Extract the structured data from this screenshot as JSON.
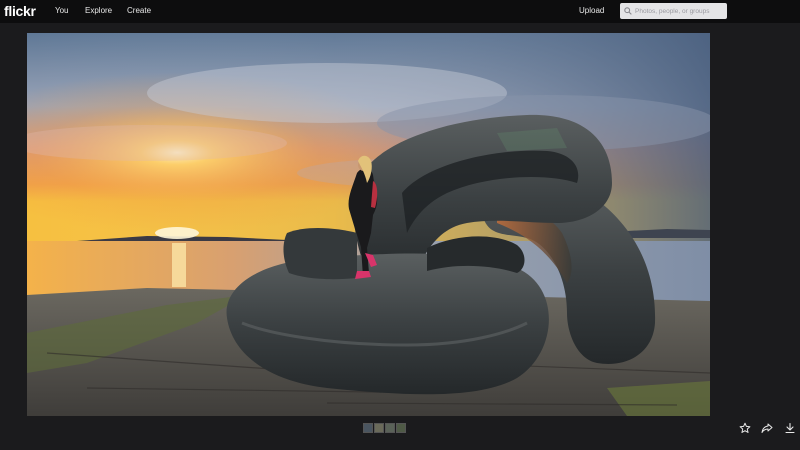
{
  "header": {
    "logo": "flickr",
    "nav": [
      {
        "label": "You"
      },
      {
        "label": "Explore"
      },
      {
        "label": "Create"
      }
    ],
    "upload_label": "Upload",
    "search": {
      "placeholder": "Photos, people, or groups",
      "icon": "search-icon",
      "value": ""
    }
  },
  "photo": {
    "subject": "giant-chain-link-sculpture-at-sunset"
  },
  "filmstrip": {
    "thumbnails": [
      {
        "color": "#4a5560"
      },
      {
        "color": "#6a6a5a"
      },
      {
        "color": "#5a6258"
      },
      {
        "color": "#4f5a46"
      }
    ]
  },
  "actions": [
    {
      "icon": "star-icon"
    },
    {
      "icon": "share-icon"
    },
    {
      "icon": "download-icon"
    }
  ],
  "colors": {
    "topbar": "#0d0d0e",
    "background": "#1b1b1d",
    "search_bg": "#e4e4e6"
  }
}
